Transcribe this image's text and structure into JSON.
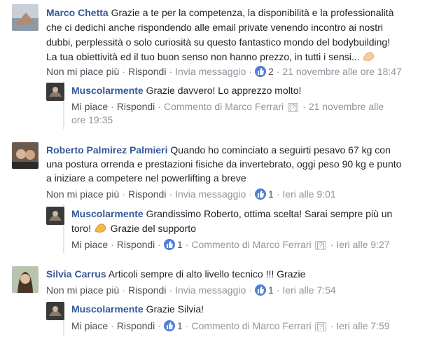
{
  "comments": [
    {
      "author": "Marco Chetta",
      "lines": [
        "Grazie a te per la competenza, la disponibilità e la professionalità",
        "che ci dedichi anche rispondendo alle email private venendo incontro ai nostri",
        "dubbi, perplessità o solo curiosità su questo fantastico mondo del bodybuilding!",
        "La tua obiettività ed il tuo buon senso non hanno prezzo, in tutti i sensi..."
      ],
      "actions": {
        "like": "Non mi piace più",
        "reply": "Rispondi",
        "message": "Invia messaggio"
      },
      "like_count": "2",
      "time": "21 novembre alle ore 18:47",
      "reply": {
        "author": "Muscolarmente",
        "text": "Grazie davvero! Lo apprezzo molto!",
        "like": "Mi piace",
        "reply": "Rispondi",
        "comment_by": "Commento di Marco Ferrari",
        "flag": "[?]",
        "time_1": "21 novembre alle",
        "time_2": "ore 19:35"
      }
    },
    {
      "author": "Roberto Palmirez Palmieri",
      "lines": [
        "Quando ho cominciato a seguirti pesavo 67 kg con",
        "una postura orrenda e prestazioni fisiche da invertebrato, oggi peso 90 kg e punto",
        "a iniziare a competere nel powerlifting a breve"
      ],
      "actions": {
        "like": "Non mi piace più",
        "reply": "Rispondi",
        "message": "Invia messaggio"
      },
      "like_count": "1",
      "time": "Ieri alle 9:01",
      "reply": {
        "author": "Muscolarmente",
        "text_1": "Grandissimo Roberto, ottima scelta! Sarai sempre più un",
        "text_2a": "toro!",
        "text_2b": "Grazie del supporto",
        "like": "Mi piace",
        "reply": "Rispondi",
        "like_count": "1",
        "comment_by": "Commento di Marco Ferrari",
        "flag": "[?]",
        "time": "Ieri alle 9:27"
      }
    },
    {
      "author": "Silvia Carrus",
      "lines": [
        "Articoli sempre di alto livello tecnico !!! Grazie"
      ],
      "actions": {
        "like": "Non mi piace più",
        "reply": "Rispondi",
        "message": "Invia messaggio"
      },
      "like_count": "1",
      "time": "Ieri alle 7:54",
      "reply": {
        "author": "Muscolarmente",
        "text": "Grazie Silvia!",
        "like": "Mi piace",
        "reply": "Rispondi",
        "like_count": "1",
        "comment_by": "Commento di Marco Ferrari",
        "flag": "[?]",
        "time": "Ieri alle 7:59"
      }
    }
  ],
  "icons": {
    "like": "thumbs-up-icon",
    "emoji": "flexed-biceps-icon"
  },
  "colors": {
    "name": "#365899",
    "like_badge": "#4f7fd9",
    "meta": "#90949c",
    "action": "#4b4f56"
  }
}
